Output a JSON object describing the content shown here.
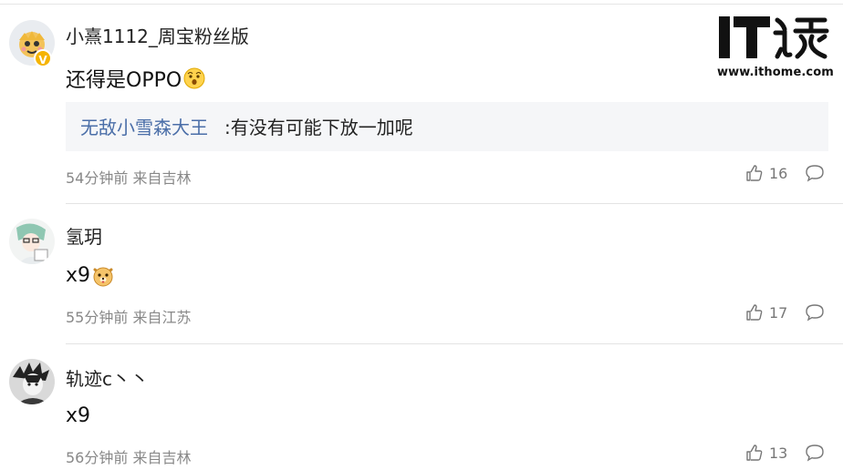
{
  "logo": {
    "url": "www.ithome.com"
  },
  "comments": [
    {
      "username": "小熹1112_周宝粉丝版",
      "content": "还得是OPPO",
      "emoji": "surprised-face-emoji",
      "verified": "V",
      "reply": {
        "name": "无敌小雪森大王",
        "text": ":有没有可能下放一加呢"
      },
      "meta": "54分钟前 来自吉林",
      "likes": "16"
    },
    {
      "username": "氢玥",
      "content": "x9",
      "emoji": "dog-face-emoji",
      "meta": "55分钟前 来自江苏",
      "likes": "17"
    },
    {
      "username": "轨迹c丶丶",
      "content": "x9",
      "meta": "56分钟前 来自吉林",
      "likes": "13"
    }
  ],
  "colors": {
    "reply_name": "#4a6ea8",
    "meta": "#888888",
    "badge": "#f5b400"
  }
}
